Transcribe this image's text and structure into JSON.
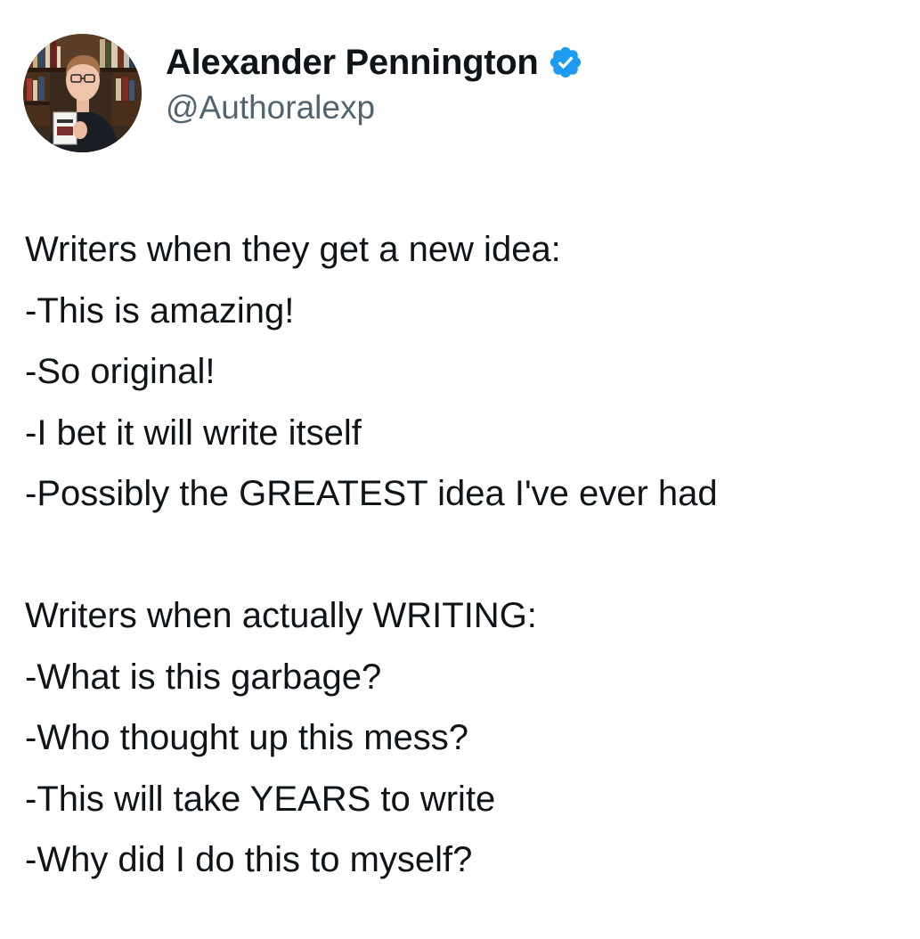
{
  "tweet": {
    "author": {
      "display_name": "Alexander Pennington",
      "handle": "@Authoralexp",
      "verified": true,
      "avatar_icon": "avatar-photo-man-holding-book",
      "verified_icon": "verified-badge-icon"
    },
    "paragraph1": {
      "lines": [
        "Writers when they get a new idea:",
        "-This is amazing!",
        "-So original!",
        "-I bet it will write itself",
        "-Possibly the GREATEST idea I've ever had"
      ]
    },
    "paragraph2": {
      "lines": [
        "Writers when actually WRITING:",
        "-What is this garbage?",
        "-Who thought up this mess?",
        "-This will take YEARS to write",
        "-Why did I do this to myself?"
      ]
    }
  },
  "colors": {
    "text": "#0f1419",
    "secondary_text": "#536471",
    "verified_blue": "#1d9bf0",
    "background": "#ffffff"
  }
}
